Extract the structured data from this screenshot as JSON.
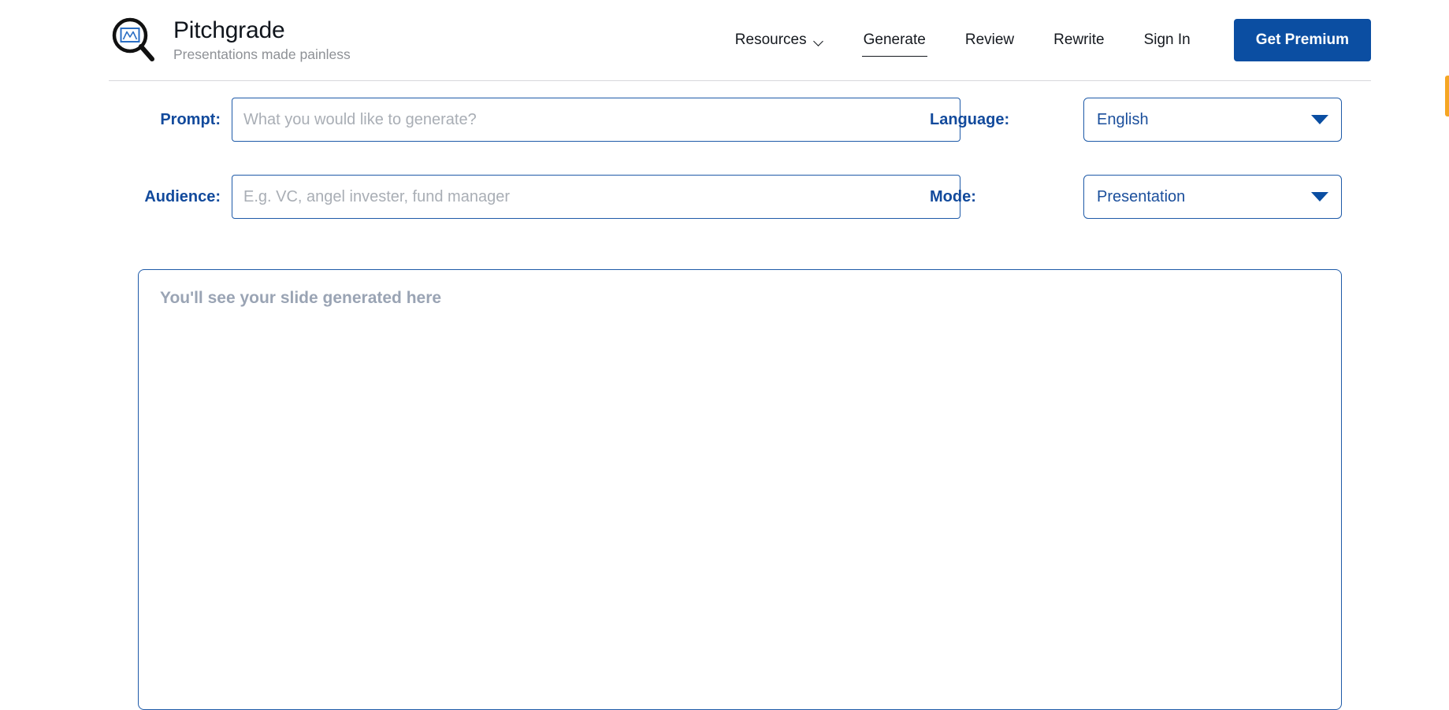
{
  "brand": {
    "title": "Pitchgrade",
    "tagline": "Presentations made painless",
    "logo_icon": "magnifier-chart-icon"
  },
  "nav": {
    "items": [
      {
        "label": "Resources",
        "has_caret": true,
        "active": false,
        "name": "nav-item-resources"
      },
      {
        "label": "Generate",
        "has_caret": false,
        "active": true,
        "name": "nav-item-generate"
      },
      {
        "label": "Review",
        "has_caret": false,
        "active": false,
        "name": "nav-item-review"
      },
      {
        "label": "Rewrite",
        "has_caret": false,
        "active": false,
        "name": "nav-item-rewrite"
      },
      {
        "label": "Sign In",
        "has_caret": false,
        "active": false,
        "name": "nav-item-sign-in"
      }
    ],
    "premium_button": "Get Premium"
  },
  "form": {
    "prompt": {
      "label": "Prompt:",
      "placeholder": "What you would like to generate?",
      "value": ""
    },
    "audience": {
      "label": "Audience:",
      "placeholder": "E.g. VC, angel invester, fund manager",
      "value": ""
    },
    "language": {
      "label": "Language:",
      "selected": "English"
    },
    "mode": {
      "label": "Mode:",
      "selected": "Presentation"
    }
  },
  "preview": {
    "placeholder": "You'll see your slide generated here"
  },
  "colors": {
    "brand_blue": "#0b4ea2",
    "label_blue": "#124a9c",
    "border_blue": "#1e5aa8",
    "placeholder_gray": "#a9aeb5",
    "preview_text_gray": "#9aa4b4",
    "accent_orange": "#f5a623"
  }
}
